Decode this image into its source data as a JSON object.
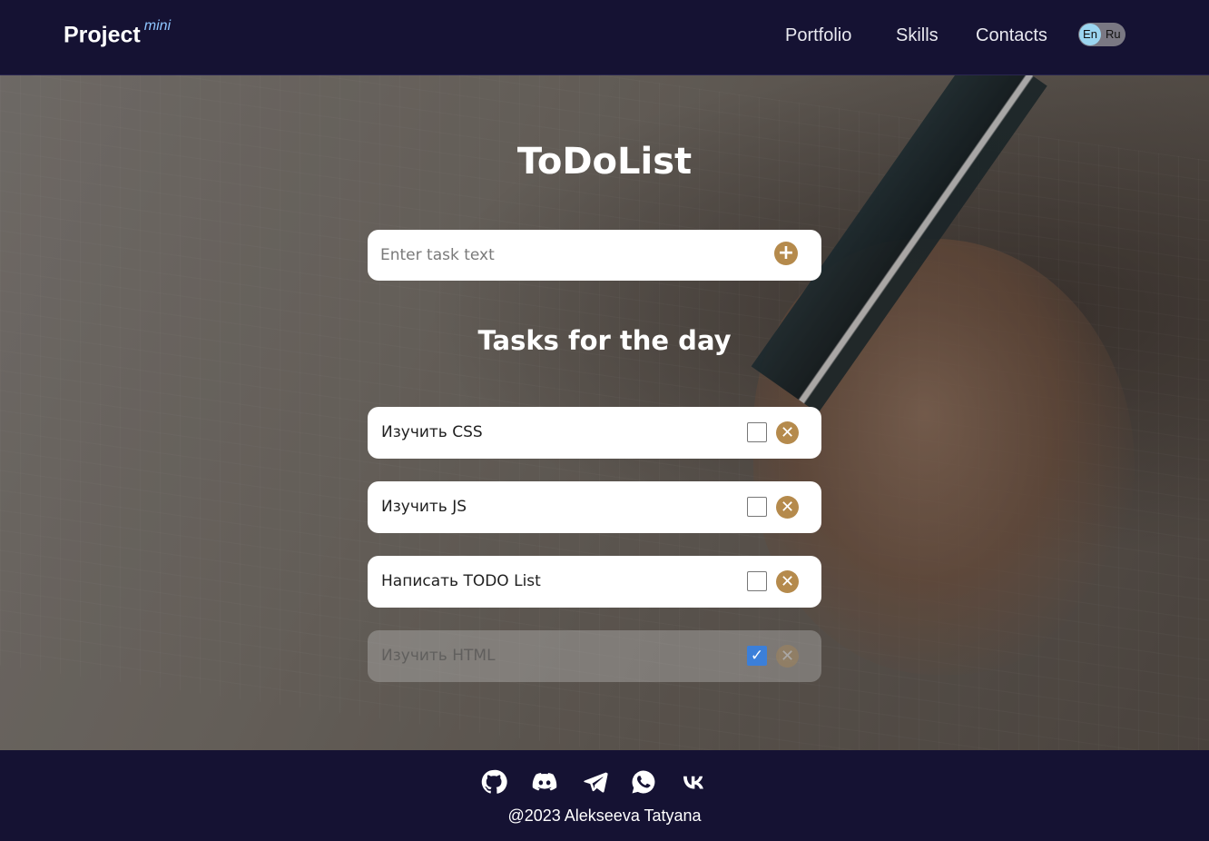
{
  "header": {
    "logo": "Project",
    "logo_sup": "mini",
    "nav": [
      "Portfolio",
      "Skills",
      "Contacts"
    ],
    "lang": {
      "en": "En",
      "ru": "Ru"
    }
  },
  "main": {
    "title": "ToDoList",
    "input_placeholder": "Enter task text",
    "add_icon": "+",
    "subtitle": "Tasks for the day",
    "tasks": [
      {
        "text": "Изучить CSS",
        "done": false
      },
      {
        "text": "Изучить JS",
        "done": false
      },
      {
        "text": "Написать TODO List",
        "done": false
      },
      {
        "text": "Изучить HTML",
        "done": true
      }
    ],
    "delete_icon": "✕",
    "check_icon": "✓"
  },
  "footer": {
    "icons": [
      "github-icon",
      "discord-icon",
      "telegram-icon",
      "whatsapp-icon",
      "vk-icon"
    ],
    "copyright": "@2023 Alekseeva Tatyana"
  }
}
